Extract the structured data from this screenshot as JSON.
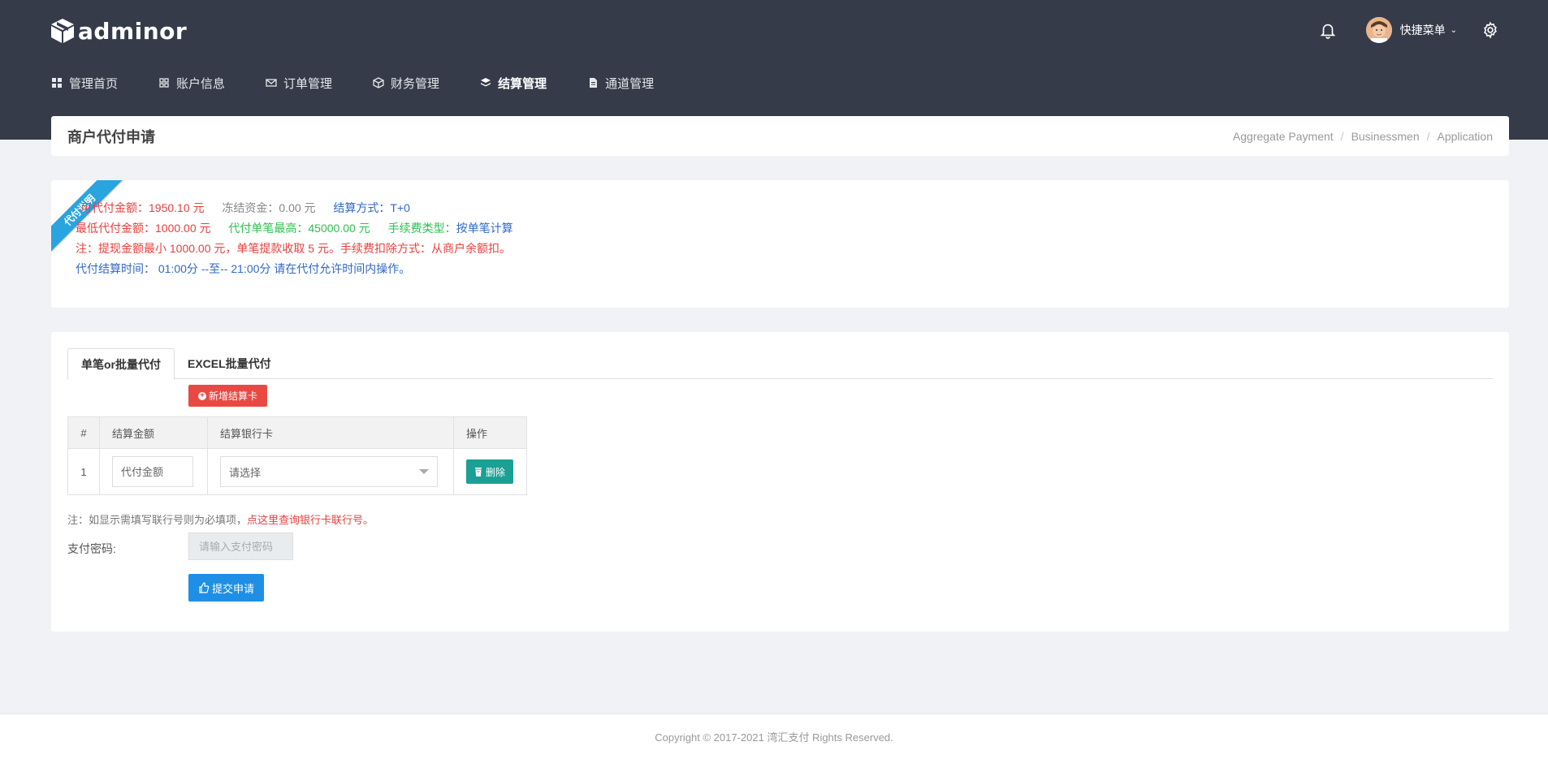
{
  "header": {
    "logo_text": "adminor",
    "quick_menu_label": "快捷菜单",
    "nav": [
      {
        "label": "管理首页"
      },
      {
        "label": "账户信息"
      },
      {
        "label": "订单管理"
      },
      {
        "label": "财务管理"
      },
      {
        "label": "结算管理"
      },
      {
        "label": "通道管理"
      }
    ]
  },
  "page": {
    "title": "商户代付申请",
    "breadcrumb": [
      "Aggregate Payment",
      "Businessmen",
      "Application"
    ]
  },
  "info": {
    "ribbon": "代付说明",
    "available_amount": "可代付金额：1950.10 元",
    "frozen_funds": "冻结资金：0.00 元",
    "settlement_method": "结算方式：T+0",
    "min_amount": "最低代付金额：1000.00 元",
    "max_single": "代付单笔最高：45000.00 元",
    "fee_type_label": "手续费类型：",
    "fee_type_value": "按单笔计算",
    "note_line": "注：提现金额最小 1000.00 元，单笔提款收取 5 元。手续费扣除方式：从商户余额扣。",
    "time_line": "代付结算时间： 01:00分 --至-- 21:00分 请在代付允许时间内操作。"
  },
  "form": {
    "tabs": [
      {
        "label": "单笔or批量代付"
      },
      {
        "label": "EXCEL批量代付"
      }
    ],
    "add_card_label": "新增结算卡",
    "table": {
      "headers": [
        "#",
        "结算金额",
        "结算银行卡",
        "操作"
      ],
      "rows": [
        {
          "index": "1",
          "amount_placeholder": "代付金额",
          "bank_placeholder": "请选择",
          "delete_label": "删除"
        }
      ]
    },
    "note_prefix": "注：如显示需填写联行号则为必填项，",
    "note_link": "点这里查询银行卡联行号。",
    "password_label": "支付密码:",
    "password_placeholder": "请输入支付密码",
    "submit_label": "提交申请"
  },
  "footer": {
    "copyright": "Copyright © 2017-2021 湾汇支付 Rights Reserved."
  },
  "colors": {
    "header_bg": "#353b48",
    "red": "#e8403f",
    "blue": "#3168c7",
    "green": "#2ec04f",
    "teal": "#1aa094",
    "primary": "#1e8fe5"
  }
}
